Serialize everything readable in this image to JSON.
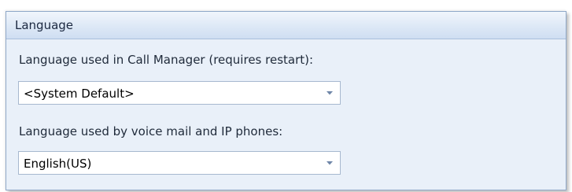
{
  "language_group": {
    "title": "Language",
    "call_manager": {
      "label": "Language used in Call Manager (requires restart):",
      "selected_value": "<System Default>"
    },
    "voice_mail": {
      "label": "Language used by voice mail and IP phones:",
      "selected_value": "English(US)"
    }
  },
  "icons": {
    "dropdown": "chevron-down-icon"
  },
  "colors": {
    "panel_background": "#e9f0f9",
    "header_gradient_top": "#f1f6fc",
    "header_gradient_bottom": "#cfdef2",
    "border": "#8fa8c8",
    "arrow": "#6f86a8"
  }
}
